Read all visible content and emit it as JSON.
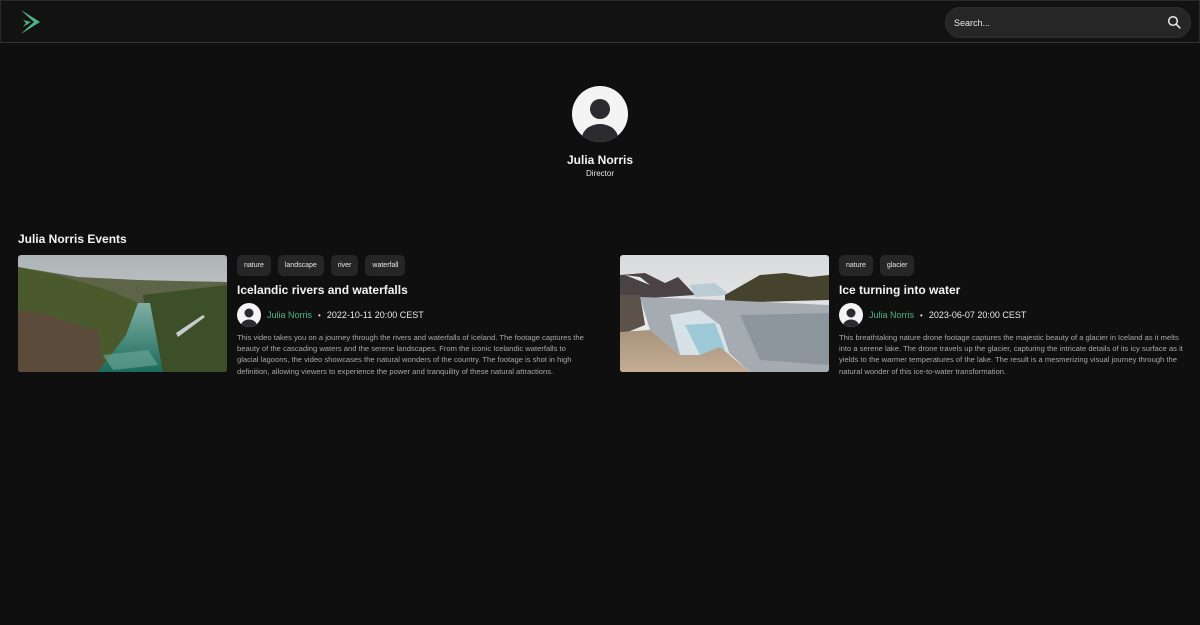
{
  "header": {
    "logo_icon": "play-arrow-logo-icon",
    "brand_color": "#4fb38a",
    "search": {
      "placeholder": "Search...",
      "value": "",
      "icon": "search-icon"
    }
  },
  "profile": {
    "avatar_icon": "user-avatar-icon",
    "name": "Julia Norris",
    "role": "Director"
  },
  "events_section": {
    "title": "Julia Norris Events",
    "events": [
      {
        "thumbnail": "river-canyon-image",
        "tags": [
          "nature",
          "landscape",
          "river",
          "waterfall"
        ],
        "title": "Icelandic rivers and waterfalls",
        "author": "Julia Norris",
        "separator": "•",
        "datetime": "2022-10-11 20:00 CEST",
        "description": "This video takes you on a journey through the rivers and waterfalls of Iceland. The footage captures the beauty of the cascading waters and the serene landscapes. From the iconic Icelandic waterfalls to glacial lagoons, the video showcases the natural wonders of the country. The footage is shot in high definition, allowing viewers to experience the power and tranquility of these natural attractions."
      },
      {
        "thumbnail": "glacier-lake-image",
        "tags": [
          "nature",
          "glacier"
        ],
        "title": "Ice turning into water",
        "author": "Julia Norris",
        "separator": "•",
        "datetime": "2023-06-07 20:00 CEST",
        "description": "This breathtaking nature drone footage captures the majestic beauty of a glacier in Iceland as it melts into a serene lake. The drone travels up the glacier, capturing the intricate details of its icy surface as it yields to the warmer temperatures of the lake. The result is a mesmerizing visual journey through the natural wonder of this ice-to-water transformation."
      }
    ]
  }
}
